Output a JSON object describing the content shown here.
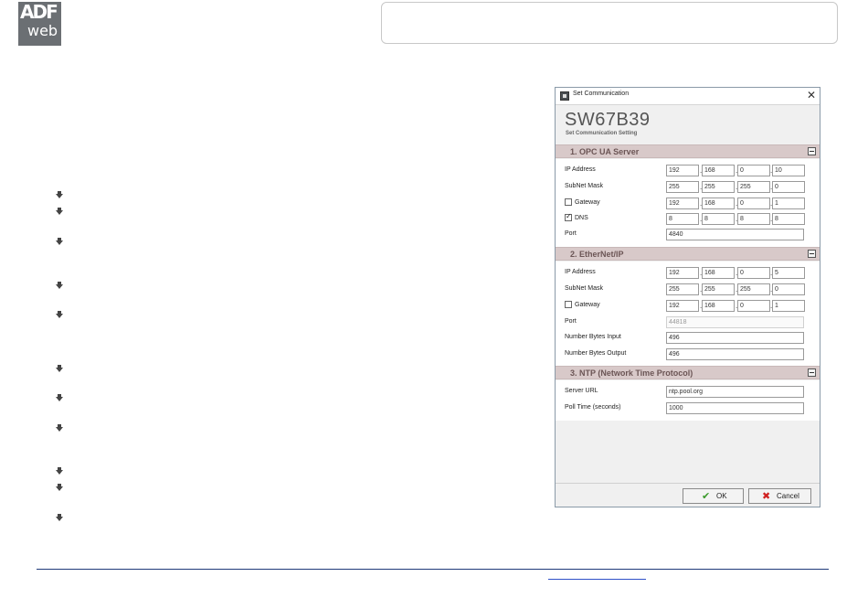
{
  "logo": {
    "line1": "ADF",
    "line2": "web"
  },
  "dialog": {
    "title": "Set Communication",
    "close_glyph": "✕",
    "heading": "SW67B39",
    "subheading": "Set Communication Setting",
    "sections": {
      "opc": {
        "title": "1. OPC UA Server",
        "ip_label": "IP Address",
        "ip": [
          "192",
          "168",
          "0",
          "10"
        ],
        "mask_label": "SubNet Mask",
        "mask": [
          "255",
          "255",
          "255",
          "0"
        ],
        "gateway_label": "Gateway",
        "gateway": [
          "192",
          "168",
          "0",
          "1"
        ],
        "dns_label": "DNS",
        "dns": [
          "8",
          "8",
          "8",
          "8"
        ],
        "port_label": "Port",
        "port": "4840"
      },
      "eip": {
        "title": "2. EtherNet/IP",
        "ip_label": "IP Address",
        "ip": [
          "192",
          "168",
          "0",
          "5"
        ],
        "mask_label": "SubNet Mask",
        "mask": [
          "255",
          "255",
          "255",
          "0"
        ],
        "gateway_label": "Gateway",
        "gateway": [
          "192",
          "168",
          "0",
          "1"
        ],
        "port_label": "Port",
        "port": "44818",
        "bytes_in_label": "Number Bytes Input",
        "bytes_in": "496",
        "bytes_out_label": "Number Bytes Output",
        "bytes_out": "496"
      },
      "ntp": {
        "title": "3. NTP (Network Time Protocol)",
        "url_label": "Server URL",
        "url": "ntp.pool.org",
        "poll_label": "Poll Time (seconds)",
        "poll": "1000"
      }
    },
    "buttons": {
      "ok": "OK",
      "cancel": "Cancel"
    }
  }
}
